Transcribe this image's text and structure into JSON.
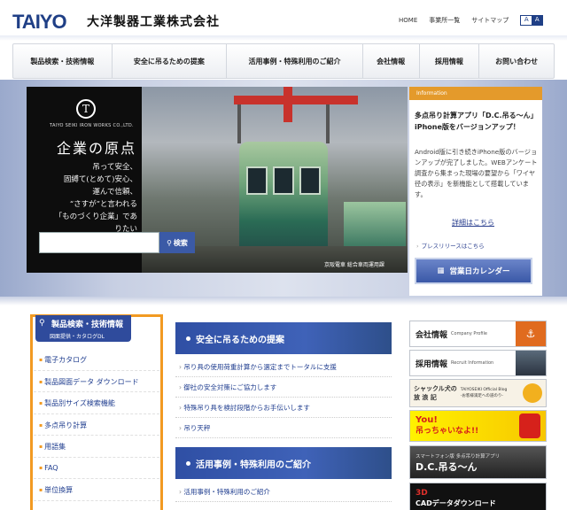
{
  "header": {
    "logo": "TAIYO",
    "company_name": "大洋製器工業株式会社",
    "links": [
      "HOME",
      "事業所一覧",
      "サイトマップ"
    ],
    "font_buttons": [
      "A",
      "A"
    ]
  },
  "nav": {
    "items": [
      "製品検索・技術情報",
      "安全に吊るための提案",
      "活用事例・特殊利用のご紹介",
      "会社情報",
      "採用情報",
      "お問い合わせ"
    ]
  },
  "hero": {
    "logo_letter": "T",
    "sub": "TAIYO SEIKI IRON WORKS CO.,LTD.",
    "title": "企業の原点",
    "lines": [
      "吊って安全、",
      "固縛て(とめて)安心、",
      "運んで信頼、",
      "“さすが”と言われる",
      "「ものづくり企業」でありたい"
    ],
    "search_button": "検索",
    "search_placeholder": "",
    "photo_caption": "京阪電車 総合車両運用課"
  },
  "info": {
    "label": "Information",
    "title": "多点吊り計算アプリ「D.C.吊る〜ん」iPhone版をバージョンアップ！",
    "body": "Android版に引き続きiPhone版のバージョンアップが完了しました。WEBアンケート調査から集まった現場の要望から「ワイヤ径の表示」を新機能として搭載しています。",
    "link": "詳細はこちら",
    "press": "プレスリリースはこちら",
    "calendar_button": "営業日カレンダー"
  },
  "products": {
    "title": "製品検索・技術情報",
    "subtitle": "図面提供・カタログDL",
    "items": [
      "電子カタログ",
      "製品図面データ ダウンロード",
      "製品別サイズ検索機能",
      "多点吊り計算",
      "用語集",
      "FAQ",
      "単位換算"
    ]
  },
  "safety": {
    "title": "安全に吊るための提案",
    "links": [
      "吊り具の使用荷重計算から選定までトータルに支援",
      "御社の安全対策にご協力します",
      "特殊吊り具を検討段階からお手伝いします",
      "吊り天秤"
    ]
  },
  "cases": {
    "title": "活用事例・特殊利用のご紹介",
    "links": [
      "活用事例・特殊利用のご紹介"
    ]
  },
  "banners": {
    "company": {
      "title": "会社情報",
      "sub": "Company Profile"
    },
    "recruit": {
      "title": "採用情報",
      "sub": "Recruit Information"
    },
    "blog": {
      "line1": "シャックル犬の",
      "line2": "放 浪 記",
      "sub1": "TAIYOSEIKI Official Blog",
      "sub2": "-お客様満足への道のり-"
    },
    "you": {
      "line1": "You!",
      "line2": "吊っちゃいなよ!!"
    },
    "app": {
      "line1": "スマートフォン版 多点吊り計算アプリ",
      "line2": "D.C.吊る〜ん"
    },
    "cad": {
      "line1": "3D",
      "line2": "CADデータダウンロード"
    }
  },
  "colors": {
    "brand_blue": "#2f4b9c",
    "accent_orange": "#f29a22",
    "link_blue": "#1f3d8f"
  }
}
